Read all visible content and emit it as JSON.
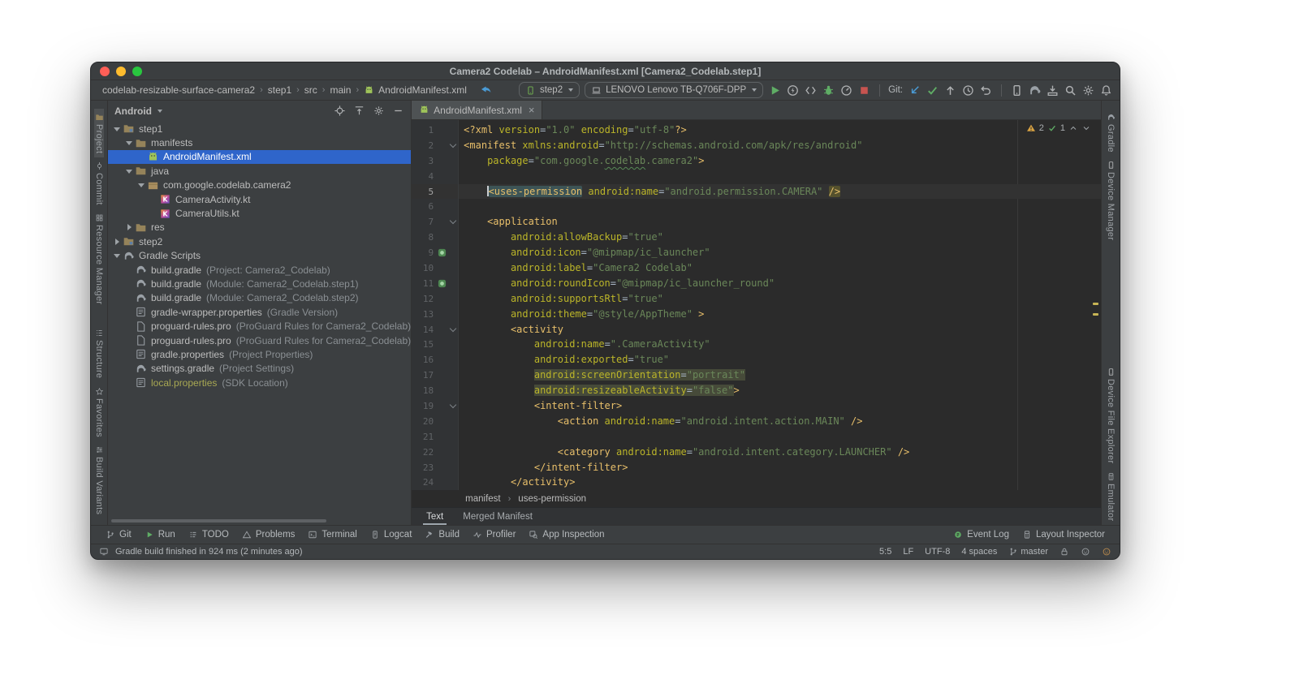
{
  "titlebar": {
    "title": "Camera2 Codelab – AndroidManifest.xml [Camera2_Codelab.step1]"
  },
  "navbar": {
    "breadcrumbs": [
      "codelab-resizable-surface-camera2",
      "step1",
      "src",
      "main",
      "AndroidManifest.xml"
    ],
    "run_config": {
      "label": "step2"
    },
    "device": {
      "label": "LENOVO Lenovo TB-Q706F-DPP"
    },
    "git_label": "Git:",
    "run_icons": [
      {
        "name": "run-icon",
        "glyph": "play"
      },
      {
        "name": "apply-changes-icon",
        "glyph": "boltcircle"
      },
      {
        "name": "apply-code-changes-icon",
        "glyph": "codearrows"
      },
      {
        "name": "debug-icon",
        "glyph": "bug"
      },
      {
        "name": "profile-icon",
        "glyph": "gauge"
      },
      {
        "name": "stop-icon",
        "glyph": "stop"
      }
    ],
    "git_icons": [
      {
        "name": "update-project-icon",
        "glyph": "arrowdl"
      },
      {
        "name": "commit-icon",
        "glyph": "checkgreen"
      },
      {
        "name": "push-icon",
        "glyph": "arrowup"
      },
      {
        "name": "history-icon",
        "glyph": "clock"
      },
      {
        "name": "rollback-icon",
        "glyph": "undo"
      }
    ],
    "misc_icons": [
      {
        "name": "device-manager-icon",
        "glyph": "phone"
      },
      {
        "name": "gradle-sync-icon",
        "glyph": "elephant"
      },
      {
        "name": "sdk-manager-icon",
        "glyph": "sdk"
      },
      {
        "name": "search-everywhere-icon",
        "glyph": "search"
      },
      {
        "name": "settings-icon",
        "glyph": "gear"
      },
      {
        "name": "notifications-icon",
        "glyph": "bell"
      }
    ]
  },
  "left_stripe": {
    "items": [
      {
        "label": "Project",
        "icon": "project-icon",
        "glyph": "folder",
        "active": true
      },
      {
        "label": "Commit",
        "icon": "commit-toolwindow-icon",
        "glyph": "commitcircle"
      },
      {
        "label": "Resource Manager",
        "icon": "resource-manager-icon",
        "glyph": "grid"
      },
      {
        "label": "Structure",
        "icon": "structure-icon",
        "glyph": "structure",
        "gap": true
      },
      {
        "label": "Favorites",
        "icon": "favorites-icon",
        "glyph": "star"
      },
      {
        "label": "Build Variants",
        "icon": "build-variants-icon",
        "glyph": "sliders"
      }
    ]
  },
  "right_stripe": {
    "top": [
      {
        "label": "Gradle",
        "icon": "gradle-icon",
        "glyph": "elephant"
      },
      {
        "label": "Device Manager",
        "icon": "device-manager-icon",
        "glyph": "phone"
      }
    ],
    "bottom": [
      {
        "label": "Device File Explorer",
        "icon": "device-file-explorer-icon",
        "glyph": "phone"
      },
      {
        "label": "Emulator",
        "icon": "emulator-icon",
        "glyph": "layout"
      }
    ]
  },
  "project_panel": {
    "view_selector": "Android",
    "header_icons": [
      {
        "name": "locate-file-icon",
        "glyph": "target"
      },
      {
        "name": "collapse-all-icon",
        "glyph": "collapse"
      },
      {
        "name": "options-gear-icon",
        "glyph": "gear"
      },
      {
        "name": "hide-panel-icon",
        "glyph": "minus"
      }
    ],
    "tree": [
      {
        "label": "step1",
        "depth": 0,
        "chevron": "down",
        "icon": "module-icon",
        "glyph": "module"
      },
      {
        "label": "manifests",
        "depth": 1,
        "chevron": "down",
        "icon": "folder-icon",
        "glyph": "folder"
      },
      {
        "label": "AndroidManifest.xml",
        "depth": 2,
        "icon": "manifest-file-icon",
        "glyph": "manifest",
        "selected": true
      },
      {
        "label": "java",
        "depth": 1,
        "chevron": "down",
        "icon": "folder-icon",
        "glyph": "folder"
      },
      {
        "label": "com.google.codelab.camera2",
        "depth": 2,
        "chevron": "down",
        "icon": "package-icon",
        "glyph": "package"
      },
      {
        "label": "CameraActivity.kt",
        "depth": 3,
        "icon": "kotlin-file-icon",
        "glyph": "kotlin"
      },
      {
        "label": "CameraUtils.kt",
        "depth": 3,
        "icon": "kotlin-file-icon",
        "glyph": "kotlin"
      },
      {
        "label": "res",
        "depth": 1,
        "chevron": "right",
        "icon": "folder-icon",
        "glyph": "folder"
      },
      {
        "label": "step2",
        "depth": 0,
        "chevron": "right",
        "icon": "module-icon",
        "glyph": "module"
      },
      {
        "label": "Gradle Scripts",
        "depth": 0,
        "chevron": "down",
        "icon": "gradle-icon",
        "glyph": "elephant"
      },
      {
        "label": "build.gradle",
        "detail": "(Project: Camera2_Codelab)",
        "depth": 1,
        "icon": "gradle-file-icon",
        "glyph": "elephant"
      },
      {
        "label": "build.gradle",
        "detail": "(Module: Camera2_Codelab.step1)",
        "depth": 1,
        "icon": "gradle-file-icon",
        "glyph": "elephant"
      },
      {
        "label": "build.gradle",
        "detail": "(Module: Camera2_Codelab.step2)",
        "depth": 1,
        "icon": "gradle-file-icon",
        "glyph": "elephant"
      },
      {
        "label": "gradle-wrapper.properties",
        "detail": "(Gradle Version)",
        "depth": 1,
        "icon": "properties-file-icon",
        "glyph": "props"
      },
      {
        "label": "proguard-rules.pro",
        "detail": "(ProGuard Rules for Camera2_Codelab)",
        "depth": 1,
        "icon": "file-icon",
        "glyph": "file"
      },
      {
        "label": "proguard-rules.pro",
        "detail": "(ProGuard Rules for Camera2_Codelab)",
        "depth": 1,
        "icon": "file-icon",
        "glyph": "file"
      },
      {
        "label": "gradle.properties",
        "detail": "(Project Properties)",
        "depth": 1,
        "icon": "properties-file-icon",
        "glyph": "props"
      },
      {
        "label": "settings.gradle",
        "detail": "(Project Settings)",
        "depth": 1,
        "icon": "gradle-file-icon",
        "glyph": "elephant"
      },
      {
        "label": "local.properties",
        "detail": "(SDK Location)",
        "depth": 1,
        "icon": "properties-file-icon",
        "glyph": "props",
        "ignored": true
      }
    ]
  },
  "editor": {
    "tab": {
      "label": "AndroidManifest.xml"
    },
    "inspections": {
      "warnings": "2",
      "ok": "1"
    },
    "breadcrumbs": [
      "manifest",
      "uses-permission"
    ],
    "bottom_tabs": [
      {
        "label": "Text",
        "active": true
      },
      {
        "label": "Merged Manifest"
      }
    ],
    "lines": [
      {
        "n": 1,
        "segs": [
          [
            "tag",
            "<?xml "
          ],
          [
            "attr",
            "version"
          ],
          [
            "pln",
            "="
          ],
          [
            "val",
            "\"1.0\""
          ],
          [
            "pln",
            " "
          ],
          [
            "attr",
            "encoding"
          ],
          [
            "pln",
            "="
          ],
          [
            "val",
            "\"utf-8\""
          ],
          [
            "tag",
            "?>"
          ]
        ]
      },
      {
        "n": 2,
        "fold": "down",
        "segs": [
          [
            "tag",
            "<manifest "
          ],
          [
            "attr",
            "xmlns:android"
          ],
          [
            "pln",
            "="
          ],
          [
            "val",
            "\"http://schemas.android.com/apk/res/android\""
          ]
        ]
      },
      {
        "n": 3,
        "segs": [
          [
            "pln",
            "    "
          ],
          [
            "attr",
            "package"
          ],
          [
            "pln",
            "="
          ],
          [
            "val",
            "\"com.google."
          ],
          [
            "val spell",
            "codelab"
          ],
          [
            "val",
            ".camera2\""
          ],
          [
            "tag",
            ">"
          ]
        ]
      },
      {
        "n": 4,
        "segs": []
      },
      {
        "n": 5,
        "caret": true,
        "segs": [
          [
            "pln",
            "    "
          ],
          [
            "caret",
            ""
          ],
          [
            "tag hl-tag",
            "<uses-permission"
          ],
          [
            "pln",
            " "
          ],
          [
            "attr",
            "android:name"
          ],
          [
            "pln",
            "="
          ],
          [
            "val",
            "\"android.permission.CAMERA\""
          ],
          [
            "pln",
            " "
          ],
          [
            "tag hl-close",
            "/>"
          ]
        ]
      },
      {
        "n": 6,
        "segs": []
      },
      {
        "n": 7,
        "fold": "down",
        "segs": [
          [
            "pln",
            "    "
          ],
          [
            "tag",
            "<application"
          ]
        ]
      },
      {
        "n": 8,
        "segs": [
          [
            "pln",
            "        "
          ],
          [
            "attr",
            "android:allowBackup"
          ],
          [
            "pln",
            "="
          ],
          [
            "val",
            "\"true\""
          ]
        ]
      },
      {
        "n": 9,
        "gicon": true,
        "segs": [
          [
            "pln",
            "        "
          ],
          [
            "attr",
            "android:icon"
          ],
          [
            "pln",
            "="
          ],
          [
            "val",
            "\"@mipmap/ic_launcher\""
          ]
        ]
      },
      {
        "n": 10,
        "segs": [
          [
            "pln",
            "        "
          ],
          [
            "attr",
            "android:label"
          ],
          [
            "pln",
            "="
          ],
          [
            "val",
            "\"Camera2 Codelab\""
          ]
        ]
      },
      {
        "n": 11,
        "gicon": true,
        "segs": [
          [
            "pln",
            "        "
          ],
          [
            "attr",
            "android:roundIcon"
          ],
          [
            "pln",
            "="
          ],
          [
            "val",
            "\"@mipmap/ic_launcher_round\""
          ]
        ]
      },
      {
        "n": 12,
        "segs": [
          [
            "pln",
            "        "
          ],
          [
            "attr",
            "android:supportsRtl"
          ],
          [
            "pln",
            "="
          ],
          [
            "val",
            "\"true\""
          ]
        ]
      },
      {
        "n": 13,
        "segs": [
          [
            "pln",
            "        "
          ],
          [
            "attr",
            "android:theme"
          ],
          [
            "pln",
            "="
          ],
          [
            "val",
            "\"@style/AppTheme\""
          ],
          [
            "pln",
            " "
          ],
          [
            "tag",
            ">"
          ]
        ]
      },
      {
        "n": 14,
        "fold": "down",
        "segs": [
          [
            "pln",
            "        "
          ],
          [
            "tag",
            "<activity"
          ]
        ]
      },
      {
        "n": 15,
        "segs": [
          [
            "pln",
            "            "
          ],
          [
            "attr",
            "android:name"
          ],
          [
            "pln",
            "="
          ],
          [
            "val",
            "\".CameraActivity\""
          ]
        ]
      },
      {
        "n": 16,
        "segs": [
          [
            "pln",
            "            "
          ],
          [
            "attr",
            "android:exported"
          ],
          [
            "pln",
            "="
          ],
          [
            "val",
            "\"true\""
          ]
        ]
      },
      {
        "n": 17,
        "segs": [
          [
            "pln",
            "            "
          ],
          [
            "attr hl-line",
            "android:screenOrientation"
          ],
          [
            "pln hl-line",
            "="
          ],
          [
            "val hl-line",
            "\"portrait\""
          ]
        ]
      },
      {
        "n": 18,
        "segs": [
          [
            "pln",
            "            "
          ],
          [
            "attr hl-line",
            "android:resizeableActivity"
          ],
          [
            "pln hl-line",
            "="
          ],
          [
            "val hl-line",
            "\"false\""
          ],
          [
            "tag",
            ">"
          ]
        ]
      },
      {
        "n": 19,
        "fold": "down",
        "segs": [
          [
            "pln",
            "            "
          ],
          [
            "tag",
            "<intent-filter>"
          ]
        ]
      },
      {
        "n": 20,
        "segs": [
          [
            "pln",
            "                "
          ],
          [
            "tag",
            "<action "
          ],
          [
            "attr",
            "android:name"
          ],
          [
            "pln",
            "="
          ],
          [
            "val",
            "\"android.intent.action.MAIN\""
          ],
          [
            "pln",
            " "
          ],
          [
            "tag",
            "/>"
          ]
        ]
      },
      {
        "n": 21,
        "segs": []
      },
      {
        "n": 22,
        "segs": [
          [
            "pln",
            "                "
          ],
          [
            "tag",
            "<category "
          ],
          [
            "attr",
            "android:name"
          ],
          [
            "pln",
            "="
          ],
          [
            "val",
            "\"android.intent.category.LAUNCHER\""
          ],
          [
            "pln",
            " "
          ],
          [
            "tag",
            "/>"
          ]
        ]
      },
      {
        "n": 23,
        "segs": [
          [
            "pln",
            "            "
          ],
          [
            "tag",
            "</intent-filter>"
          ]
        ]
      },
      {
        "n": 24,
        "segs": [
          [
            "pln",
            "        "
          ],
          [
            "tag",
            "</activity>"
          ]
        ]
      }
    ]
  },
  "tool_buttons": {
    "left": [
      {
        "label": "Git",
        "glyph": "branch"
      },
      {
        "label": "Run",
        "glyph": "playsm"
      },
      {
        "label": "TODO",
        "glyph": "todo"
      },
      {
        "label": "Problems",
        "glyph": "trigray"
      },
      {
        "label": "Terminal",
        "glyph": "terminal"
      },
      {
        "label": "Logcat",
        "glyph": "logcat"
      },
      {
        "label": "Build",
        "glyph": "hammer"
      },
      {
        "label": "Profiler",
        "glyph": "pulse"
      },
      {
        "label": "App Inspection",
        "glyph": "inspectbox"
      }
    ],
    "right": [
      {
        "label": "Event Log",
        "glyph": "eventlog"
      },
      {
        "label": "Layout Inspector",
        "glyph": "layout"
      }
    ]
  },
  "status_bar": {
    "message": "Gradle build finished in 924 ms (2 minutes ago)",
    "caret_position": "5:5",
    "line_ending": "LF",
    "encoding": "UTF-8",
    "indent": "4 spaces",
    "git_branch": "master"
  },
  "colors": {
    "selection_blue": "#2f65ca",
    "editor_bg": "#2b2b2b",
    "panel_bg": "#3c3f41",
    "xml_tag": "#e8bf6a",
    "xml_attribute": "#bbb529",
    "xml_value": "#6a8759",
    "run_green": "#5fad65",
    "stop_red": "#c75450",
    "warning_yellow": "#d9a343"
  }
}
